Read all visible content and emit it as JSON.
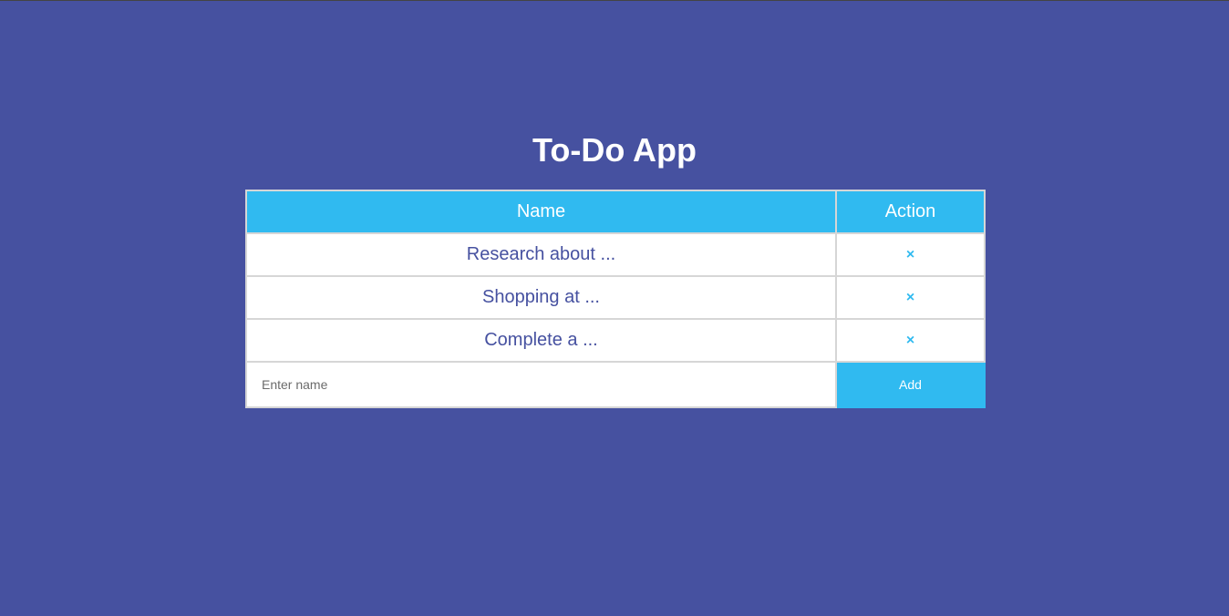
{
  "app": {
    "title": "To-Do App"
  },
  "table": {
    "headers": {
      "name": "Name",
      "action": "Action"
    },
    "rows": [
      {
        "name": "Research about ...",
        "remove": "×"
      },
      {
        "name": "Shopping at ...",
        "remove": "×"
      },
      {
        "name": "Complete a ...",
        "remove": "×"
      }
    ]
  },
  "form": {
    "input_value": "",
    "input_placeholder": "Enter name",
    "add_label": "Add"
  },
  "colors": {
    "background": "#4651a0",
    "accent": "#30baf0",
    "text": "#4651a0"
  }
}
